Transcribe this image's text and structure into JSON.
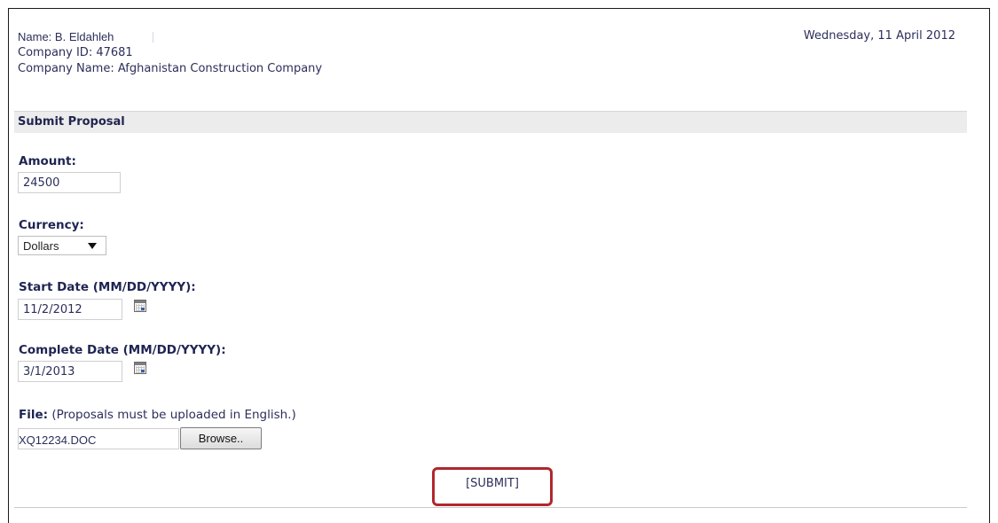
{
  "user": {
    "name_label": "Name:",
    "name_value": "B. Eldahleh",
    "company_id": "Company ID: 47681",
    "company_name": "Company Name: Afghanistan Construction Company"
  },
  "date": "Wednesday, 11 April 2012",
  "section_title": "Submit Proposal",
  "form": {
    "amount_label": "Amount:",
    "amount_value": "24500",
    "currency_label": "Currency:",
    "currency_value": "Dollars",
    "start_date_label": "Start Date (MM/DD/YYYY):",
    "start_date_value": "11/2/2012",
    "complete_date_label": "Complete Date (MM/DD/YYYY):",
    "complete_date_value": "3/1/2013",
    "file_label": "File:",
    "file_note": "(Proposals must be uploaded in English.)",
    "file_value": "XQ12234.DOC",
    "browse_label": "Browse..",
    "submit_label": "[SUBMIT]"
  },
  "icons": {
    "calendar": "calendar-icon",
    "dropdown": "chevron-down-icon"
  },
  "colors": {
    "highlight_border": "#b0272e",
    "section_bar": "#ececec",
    "label_text": "#1f2452"
  }
}
